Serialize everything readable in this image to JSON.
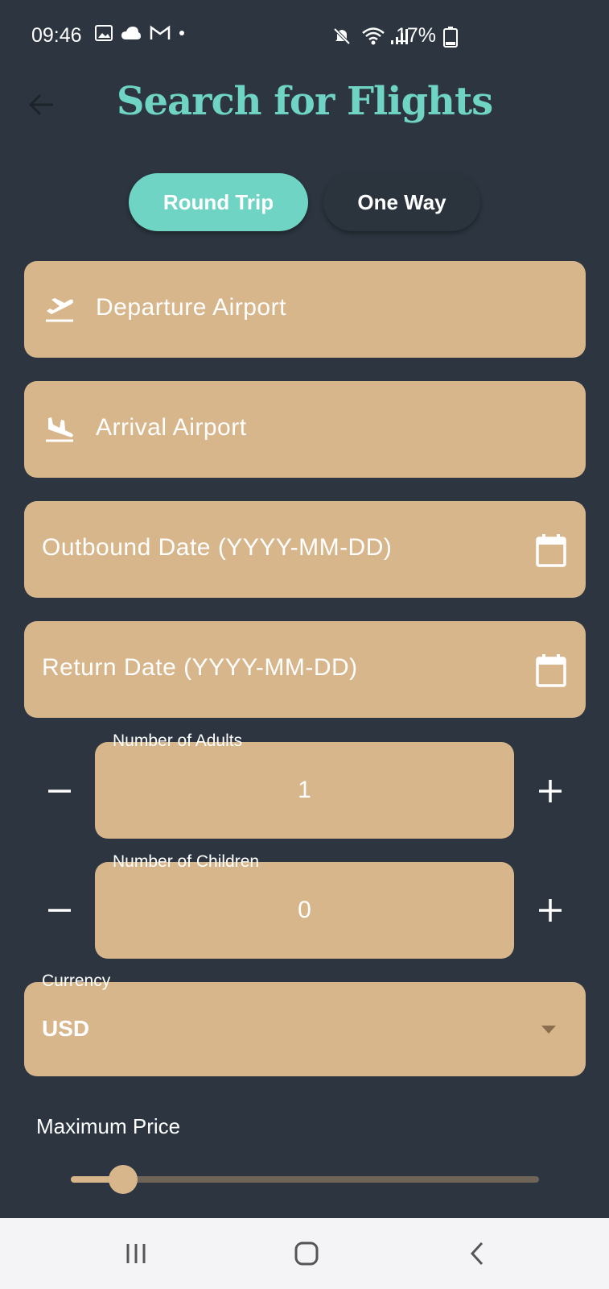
{
  "status_bar": {
    "time": "09:46",
    "battery": "17%"
  },
  "header": {
    "title": "Search for Flights"
  },
  "trip_type": {
    "options": [
      "Round Trip",
      "One Way"
    ],
    "selected": "Round Trip",
    "active_color": "#6fd4c3"
  },
  "fields": {
    "departure_placeholder": "Departure Airport",
    "arrival_placeholder": "Arrival Airport",
    "outbound_placeholder": "Outbound Date (YYYY-MM-DD)",
    "return_placeholder": "Return Date (YYYY-MM-DD)"
  },
  "passengers": {
    "adults_label": "Number of Adults",
    "adults_value": "1",
    "children_label": "Number of Children",
    "children_value": "0",
    "decrement_symbol": "—",
    "increment_symbol": "+"
  },
  "currency": {
    "label": "Currency",
    "value": "USD"
  },
  "price": {
    "label": "Maximum Price",
    "slider_fraction": 0.05
  },
  "colors": {
    "background": "#2c3540",
    "field": "#d7b68b",
    "accent": "#6fd4c3"
  },
  "icons": {
    "departure": "flight-takeoff-icon",
    "arrival": "flight-land-icon",
    "date": "calendar-icon",
    "dropdown": "dropdown-arrow-icon"
  }
}
